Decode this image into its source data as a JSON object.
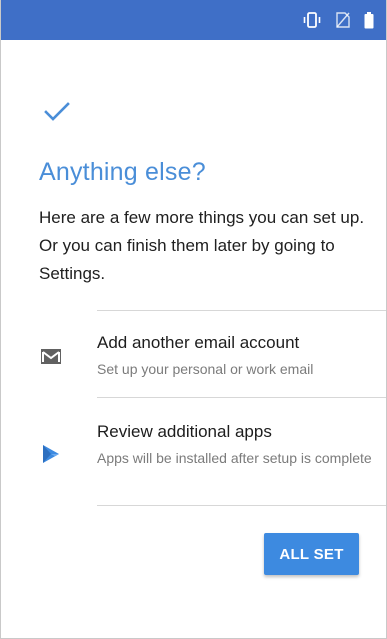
{
  "status_bar": {
    "icons": [
      "vibrate-icon",
      "no-sim-icon",
      "battery-icon"
    ],
    "color": "#3f6fc7"
  },
  "header": {
    "check_icon": "checkmark-icon",
    "title": "Anything else?",
    "description": "Here are a few more things you can set up. Or you can finish them later by going to Settings."
  },
  "options": [
    {
      "icon": "gmail-icon",
      "title": "Add another email account",
      "subtitle": "Set up your personal or work email"
    },
    {
      "icon": "play-store-icon",
      "title": "Review additional apps",
      "subtitle": "Apps will be installed after setup is complete"
    }
  ],
  "footer": {
    "primary_label": "ALL SET"
  },
  "colors": {
    "accent": "#4a8ed8",
    "button": "#3d8ae0"
  }
}
